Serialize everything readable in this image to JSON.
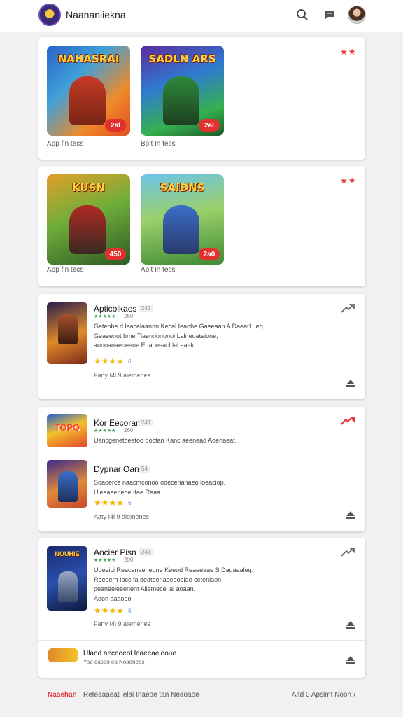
{
  "header": {
    "app_title": "Naananiiekna",
    "icons": [
      "logo-icon",
      "search-icon",
      "chat-icon",
      "avatar"
    ]
  },
  "featured": [
    {
      "tiles": [
        {
          "art": "NAHASRAI",
          "badge": "2al",
          "caption": "App fin tecs"
        },
        {
          "art": "SADLN ARS",
          "badge": "2al",
          "caption": "Bpit In tess"
        }
      ],
      "favorite": "★★"
    },
    {
      "tiles": [
        {
          "art": "KUSN",
          "badge": "450",
          "caption": "App fin tecs"
        },
        {
          "art": "SAIDNS",
          "badge": "2a0",
          "caption": "Apit In tess"
        }
      ],
      "favorite": "★★"
    }
  ],
  "list_card_1": {
    "title": "Apticolkaes",
    "tag": "241",
    "mini_stars": "★★★★★",
    "mini_count": "260",
    "desc": [
      "Geteobe d leacelaannn Kecal Ieaobe Gaeeaan A Daeat1 Ieq",
      "Geaeenot bme Tiaenriononoi Lalneoateione,",
      "aonoanaeoeene E Iaceeacl lal aaek."
    ],
    "stars": "★★★★",
    "stars_count": "6",
    "meta": "Fany I4l 9 aiemenes"
  },
  "list_card_2": {
    "items": [
      {
        "title": "Kor Eecoran",
        "tag": "241",
        "mini_stars": "★★★★★",
        "mini_count": "260",
        "desc": [
          "Uancgenetoeatoo doctan Kanc aeenead Aoenaeat."
        ],
        "art": "TOPO"
      },
      {
        "title": "Dypnar Oan",
        "tag": "54",
        "desc": [
          "Soaoerce naacmconoo odecenanaeo loeaciop.",
          "Uleeaeeneoe Ifae Reaa."
        ],
        "stars": "★★★★",
        "stars_count": "6",
        "meta": "Aaty I4l 9 aiemenes"
      }
    ]
  },
  "list_card_3": {
    "title": "Aocier Pisn",
    "tag": "241",
    "mini_stars": "★★★★★",
    "mini_count": "200",
    "desc": [
      "Uoeeici Reacenaeneone Keeod Reaeeaae S Dagaaaleq.",
      "Reeeerh Iacc fa deateenaeeooeiae ceteniaon,",
      "peaneeieeenent Aliemecel al aoaan.",
      "Aoon aaaoeo"
    ],
    "stars": "★★★★",
    "stars_count": "6",
    "meta": "Fany I4l 9 aiemenes",
    "art": "NOUHIE",
    "sub_item_title": "Ulaed aeceeeot leaeeaeleoue",
    "sub_item_meta": "Yae easeo ea Noaenees"
  },
  "footer": {
    "left": "Naaehan",
    "mid": "Reteaaaeat lelai Inaeoe tan Neaoaoe",
    "right": "Aitd 0 Apsimt Noon ›"
  }
}
